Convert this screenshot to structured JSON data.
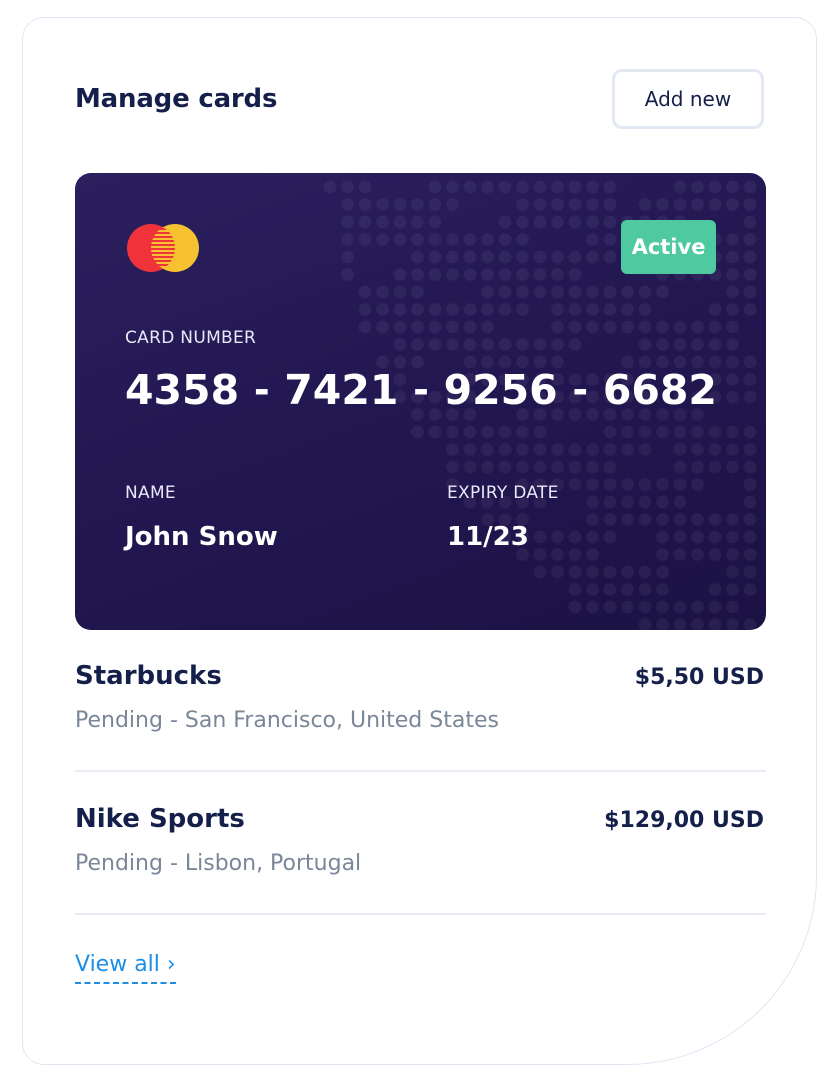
{
  "header": {
    "title": "Manage cards",
    "add_button_label": "Add new"
  },
  "card": {
    "brand_icon": "mastercard-logo",
    "status": "Active",
    "number_label": "CARD NUMBER",
    "number_groups": [
      "4358",
      "7421",
      "9256",
      "6682"
    ],
    "separator": "-",
    "name_label": "NAME",
    "name_value": "John Snow",
    "expiry_label": "EXPIRY DATE",
    "expiry_value": "11/23"
  },
  "transactions": [
    {
      "merchant": "Starbucks",
      "details": "Pending - San Francisco, United States",
      "amount": "$5,50 USD"
    },
    {
      "merchant": "Nike Sports",
      "details": "Pending - Lisbon, Portugal",
      "amount": "$129,00 USD"
    }
  ],
  "footer": {
    "view_all_label": "View all ›"
  },
  "colors": {
    "title": "#14204a",
    "card_bg": "#221650",
    "badge": "#4fc9a0",
    "link": "#1d8ee6",
    "muted": "#7a8799"
  }
}
